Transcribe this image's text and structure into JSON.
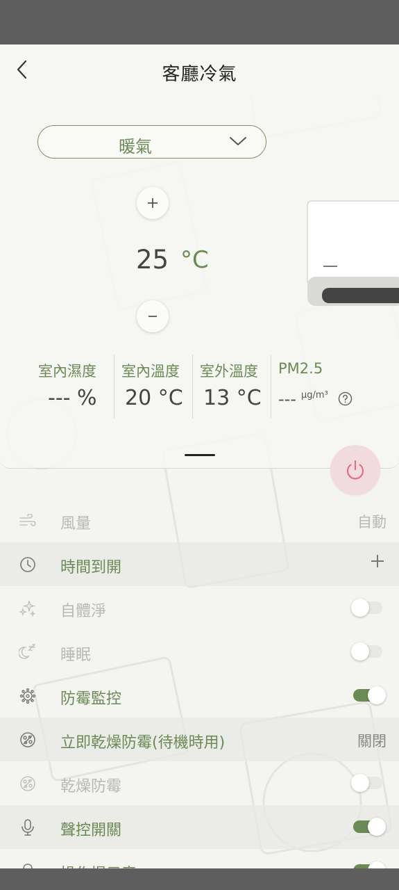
{
  "header": {
    "title": "客廳冷氣",
    "back_icon": "chevron-left-icon"
  },
  "mode": {
    "selected": "暖氣",
    "icon": "chevron-down-icon"
  },
  "temperature": {
    "value": "25",
    "unit": "°C",
    "increase_icon": "plus-icon",
    "decrease_icon": "minus-icon"
  },
  "stats": {
    "indoor_humidity": {
      "label": "室內濕度",
      "value": "--- %"
    },
    "indoor_temp": {
      "label": "室內溫度",
      "value": "20 °C"
    },
    "outdoor_temp": {
      "label": "室外溫度",
      "value": "13 °C"
    },
    "pm25": {
      "label": "PM2.5",
      "value": "---",
      "unit": "μg/m³",
      "help_icon": "question-circle-icon"
    }
  },
  "power": {
    "icon": "power-icon",
    "color": "#e0707e"
  },
  "settings": [
    {
      "label": "風量",
      "value": "自動",
      "icon": "wind-icon",
      "state": "disabled"
    },
    {
      "label": "時間到開",
      "icon": "clock-icon",
      "action": "plus-icon",
      "state": "enabled"
    },
    {
      "label": "自體淨",
      "icon": "sparkle-icon",
      "toggle": false,
      "state": "disabled"
    },
    {
      "label": "睡眠",
      "icon": "moon-sleep-icon",
      "toggle": false,
      "state": "disabled"
    },
    {
      "label": "防霉監控",
      "icon": "mold-icon",
      "toggle": true,
      "state": "enabled"
    },
    {
      "label": "立即乾燥防霉(待機時用)",
      "value": "關閉",
      "icon": "dry-mold-icon",
      "state": "enabled"
    },
    {
      "label": "乾燥防霉",
      "icon": "dry-mold-icon",
      "toggle": false,
      "state": "disabled"
    },
    {
      "label": "聲控開關",
      "icon": "microphone-icon",
      "toggle": true,
      "state": "enabled"
    },
    {
      "label": "操作提示音",
      "icon": "bell-icon",
      "toggle": true,
      "state": "enabled"
    }
  ],
  "colors": {
    "accent": "#6b8a55",
    "power_bg": "#f2dbdf",
    "background": "#f4f4f1"
  }
}
